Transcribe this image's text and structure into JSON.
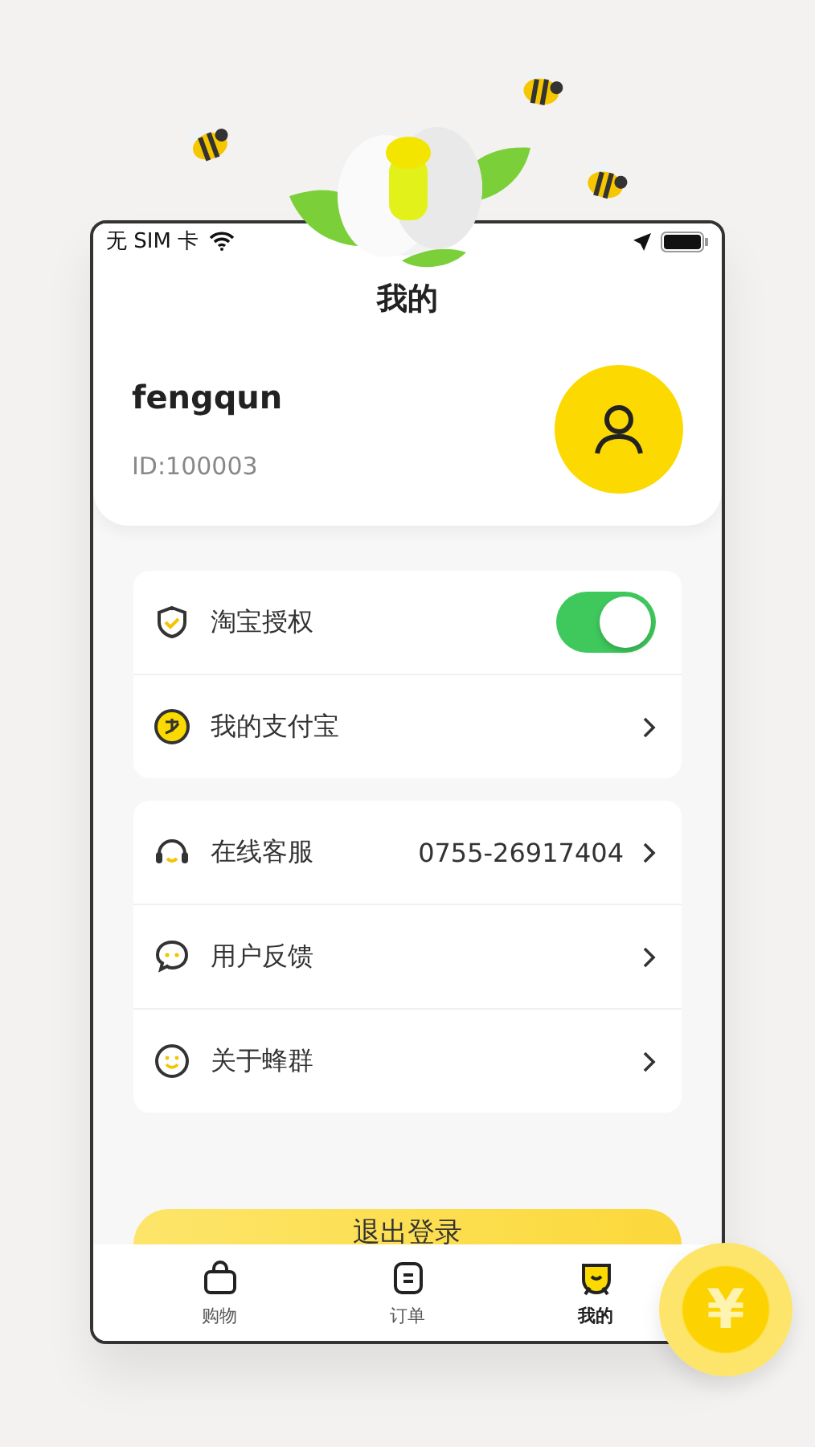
{
  "status_bar": {
    "carrier": "无 SIM 卡"
  },
  "title": "我的",
  "profile": {
    "name": "fengqun",
    "id": "ID:100003"
  },
  "menu_groups": [
    {
      "items": [
        {
          "kind": "toggle",
          "label": "淘宝授权",
          "on": true
        },
        {
          "kind": "link",
          "label": "我的支付宝"
        }
      ]
    },
    {
      "items": [
        {
          "kind": "link",
          "label": "在线客服",
          "value": "0755-26917404"
        },
        {
          "kind": "link",
          "label": "用户反馈"
        },
        {
          "kind": "link",
          "label": "关于蜂群"
        }
      ]
    }
  ],
  "logout_button": "退出登录",
  "tab_bar": [
    {
      "label": "购物",
      "selected": false
    },
    {
      "label": "订单",
      "selected": false
    },
    {
      "label": "我的",
      "selected": true
    }
  ],
  "coin": {
    "symbol": "¥"
  }
}
